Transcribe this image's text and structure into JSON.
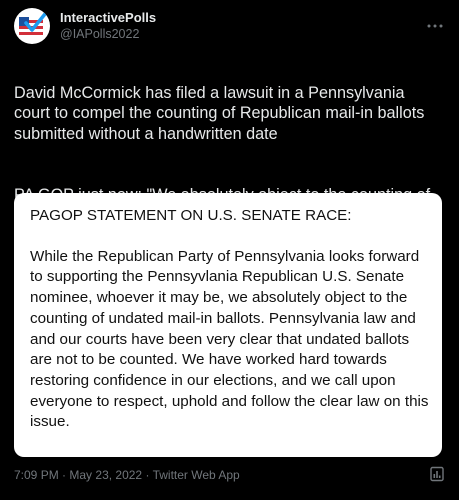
{
  "author": {
    "display_name": "InteractivePolls",
    "handle": "@IAPolls2022",
    "avatar_icon": "flag-checkmark-icon"
  },
  "more_icon": "more-horizontal-icon",
  "tweet": {
    "paragraph_1": "David McCormick has filed a lawsuit in a Pennsylvania court to compel the counting of Republican mail-in ballots submitted without a handwritten date",
    "paragraph_2": "PA GOP just now: \"We absolutely object to the counting of undated mail-in ballots\""
  },
  "statement": {
    "title": "PAGOP STATEMENT ON U.S. SENATE RACE:",
    "body": "While the Republican Party of Pennsylvania looks forward to supporting the Pennsyvlania Republican U.S. Senate nominee, whoever it may be, we absolutely object to the counting of undated mail-in ballots. Pennsylvania law and and our courts have been very clear that undated ballots are not to be counted.  We have worked hard towards restoring confidence in our elections, and we call upon everyone to respect, uphold and follow the clear law on this issue."
  },
  "footer": {
    "time": "7:09 PM",
    "date": "May 23, 2022",
    "source": "Twitter Web App",
    "separator": "·",
    "analytics_icon": "analytics-icon"
  },
  "colors": {
    "background": "#000000",
    "text": "#e7e9ea",
    "muted": "#71767b",
    "flag_red": "#d22f3a",
    "flag_blue": "#1d4f9c",
    "check_blue": "#1d9bf0"
  }
}
